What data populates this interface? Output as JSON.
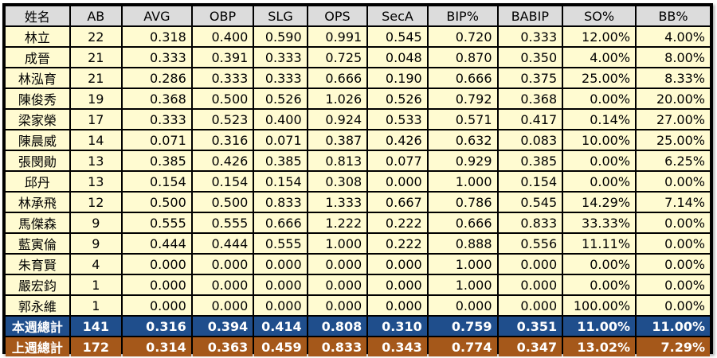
{
  "table": {
    "headers": [
      "姓名",
      "AB",
      "AVG",
      "OBP",
      "SLG",
      "OPS",
      "SecA",
      "BIP%",
      "BABIP",
      "SO%",
      "BB%"
    ],
    "rows": [
      [
        "林立",
        "22",
        "0.318",
        "0.400",
        "0.590",
        "0.991",
        "0.545",
        "0.720",
        "0.333",
        "12.00%",
        "4.00%"
      ],
      [
        "成晉",
        "21",
        "0.333",
        "0.391",
        "0.333",
        "0.725",
        "0.048",
        "0.870",
        "0.350",
        "4.00%",
        "8.00%"
      ],
      [
        "林泓育",
        "21",
        "0.286",
        "0.333",
        "0.333",
        "0.666",
        "0.190",
        "0.666",
        "0.375",
        "25.00%",
        "8.33%"
      ],
      [
        "陳俊秀",
        "19",
        "0.368",
        "0.500",
        "0.526",
        "1.026",
        "0.526",
        "0.792",
        "0.368",
        "0.00%",
        "20.00%"
      ],
      [
        "梁家榮",
        "17",
        "0.333",
        "0.523",
        "0.400",
        "0.924",
        "0.533",
        "0.571",
        "0.417",
        "0.14%",
        "27.00%"
      ],
      [
        "陳晨威",
        "14",
        "0.071",
        "0.316",
        "0.071",
        "0.387",
        "0.426",
        "0.632",
        "0.083",
        "10.00%",
        "25.00%"
      ],
      [
        "張閔勛",
        "13",
        "0.385",
        "0.426",
        "0.385",
        "0.813",
        "0.077",
        "0.929",
        "0.385",
        "0.00%",
        "6.25%"
      ],
      [
        "邱丹",
        "13",
        "0.154",
        "0.154",
        "0.154",
        "0.308",
        "0.000",
        "1.000",
        "0.154",
        "0.00%",
        "0.00%"
      ],
      [
        "林承飛",
        "12",
        "0.500",
        "0.500",
        "0.833",
        "1.333",
        "0.667",
        "0.786",
        "0.545",
        "14.29%",
        "7.14%"
      ],
      [
        "馬傑森",
        "9",
        "0.555",
        "0.555",
        "0.666",
        "1.222",
        "0.222",
        "0.666",
        "0.833",
        "33.33%",
        "0.00%"
      ],
      [
        "藍寅倫",
        "9",
        "0.444",
        "0.444",
        "0.555",
        "1.000",
        "0.222",
        "0.888",
        "0.556",
        "11.11%",
        "0.00%"
      ],
      [
        "朱育賢",
        "4",
        "0.000",
        "0.000",
        "0.000",
        "0.000",
        "0.000",
        "1.000",
        "0.000",
        "0.00%",
        "0.00%"
      ],
      [
        "嚴宏鈞",
        "1",
        "0.000",
        "0.000",
        "0.000",
        "0.000",
        "0.000",
        "1.000",
        "0.000",
        "0.00%",
        "0.00%"
      ],
      [
        "郭永維",
        "1",
        "0.000",
        "0.000",
        "0.000",
        "0.000",
        "0.000",
        "0.000",
        "0.000",
        "100.00%",
        "0.00%"
      ]
    ],
    "total_this_week": [
      "本週總計",
      "141",
      "0.316",
      "0.394",
      "0.414",
      "0.808",
      "0.310",
      "0.759",
      "0.351",
      "11.00%",
      "11.00%"
    ],
    "total_last_week": [
      "上週總計",
      "172",
      "0.314",
      "0.363",
      "0.459",
      "0.833",
      "0.343",
      "0.774",
      "0.347",
      "13.02%",
      "7.29%"
    ]
  },
  "colors": {
    "header_bg": "#dcdcdc",
    "cell_bg": "#fffbd1",
    "this_week_bg": "#1f4e8c",
    "last_week_bg": "#a5581a",
    "border": "#000000"
  }
}
